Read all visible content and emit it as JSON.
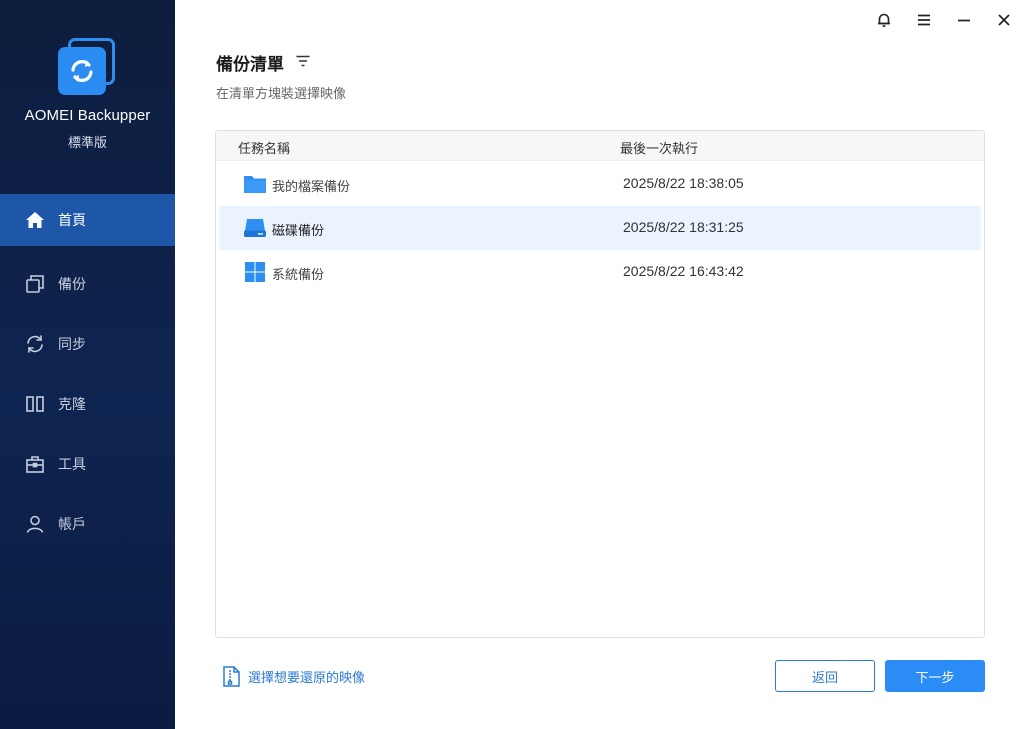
{
  "app": {
    "name": "AOMEI Backupper",
    "edition": "標準版"
  },
  "sidebar": {
    "items": [
      {
        "label": "首頁",
        "icon": "home-icon",
        "active": true
      },
      {
        "label": "備份",
        "icon": "backup-icon",
        "active": false
      },
      {
        "label": "同步",
        "icon": "sync-icon",
        "active": false
      },
      {
        "label": "克隆",
        "icon": "clone-icon",
        "active": false
      },
      {
        "label": "工具",
        "icon": "toolbox-icon",
        "active": false
      },
      {
        "label": "帳戶",
        "icon": "user-icon",
        "active": false
      }
    ]
  },
  "window_controls": [
    "bell-icon",
    "menu-icon",
    "minimize-icon",
    "close-icon"
  ],
  "header": {
    "title": "備份清單",
    "subtitle": "在清單方塊裝選擇映像"
  },
  "table": {
    "columns": [
      "任務名稱",
      "最後一次執行"
    ],
    "rows": [
      {
        "name": "我的檔案備份",
        "last_run": "2025/8/22 18:38:05",
        "icon": "folder-icon",
        "selected": false
      },
      {
        "name": "磁碟備份",
        "last_run": "2025/8/22 18:31:25",
        "icon": "disk-icon",
        "selected": true
      },
      {
        "name": "系統備份",
        "last_run": "2025/8/22 16:43:42",
        "icon": "windows-icon",
        "selected": false
      }
    ]
  },
  "footer": {
    "restore_link": "選擇想要還原的映像",
    "back_label": "返回",
    "next_label": "下一步"
  },
  "colors": {
    "accent": "#2a8cf4",
    "sidebar_bg": "#0e2450",
    "active_nav": "#1f57a8",
    "selected_row": "#eaf3fe"
  }
}
